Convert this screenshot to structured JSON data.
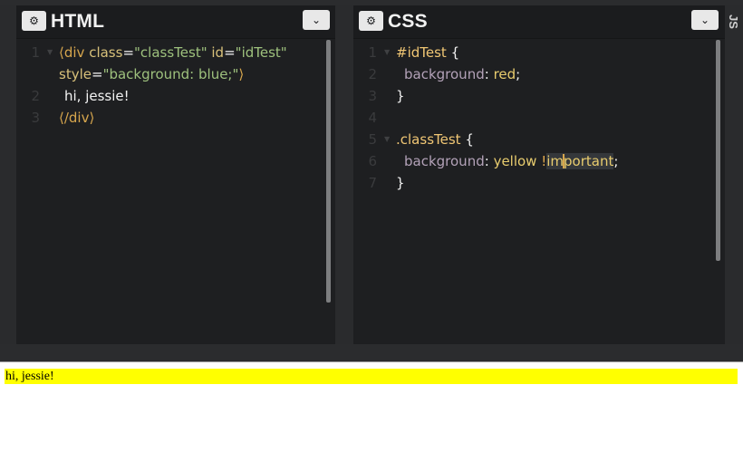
{
  "html_panel": {
    "title": "HTML",
    "gear_icon": "gear-icon",
    "collapse_icon": "chevron-down-icon",
    "lines": [
      {
        "num": "1",
        "foldable": true
      },
      {
        "num": "",
        "foldable": false
      },
      {
        "num": "2",
        "foldable": false
      },
      {
        "num": "3",
        "foldable": false
      }
    ],
    "tokens": {
      "l1_open": "⟨div",
      "l1_attr_class": "class",
      "l1_eq1": "=",
      "l1_str_class": "\"classTest\"",
      "l1_attr_id": "id",
      "l1_eq2": "=",
      "l1_str_id": "\"idTest\"",
      "l1b_attr_style": "style",
      "l1b_eq": "=",
      "l1b_str_style": "\"background: blue;\"",
      "l1b_close": "⟩",
      "l2_text": "hi, jessie!",
      "l3_close": "⟨/div⟩"
    }
  },
  "css_panel": {
    "title": "CSS",
    "gear_icon": "gear-icon",
    "collapse_icon": "chevron-down-icon",
    "line_numbers": [
      "1",
      "2",
      "3",
      "4",
      "5",
      "6",
      "7"
    ],
    "tokens": {
      "l1_selector": "#idTest",
      "l1_brace": "{",
      "l2_prop": "background",
      "l2_colon": ":",
      "l2_value": "red",
      "l2_semi": ";",
      "l3_brace": "}",
      "l5_selector": ".classTest",
      "l5_brace": "{",
      "l6_prop": "background",
      "l6_colon": ":",
      "l6_value": "yellow",
      "l6_bang": "!",
      "l6_imp_a": "im",
      "l6_imp_b": "portant",
      "l6_semi": ";",
      "l7_brace": "}"
    }
  },
  "js_tab": {
    "label": "JS"
  },
  "preview": {
    "text": "hi, jessie!",
    "background": "#ffff00"
  },
  "colors": {
    "editor_bg": "#1e1f21",
    "selector": "#f0c674",
    "property": "#b3a2b8",
    "value": "#e8cc6e",
    "string": "#9ec17d",
    "tag": "#d7a64d"
  }
}
